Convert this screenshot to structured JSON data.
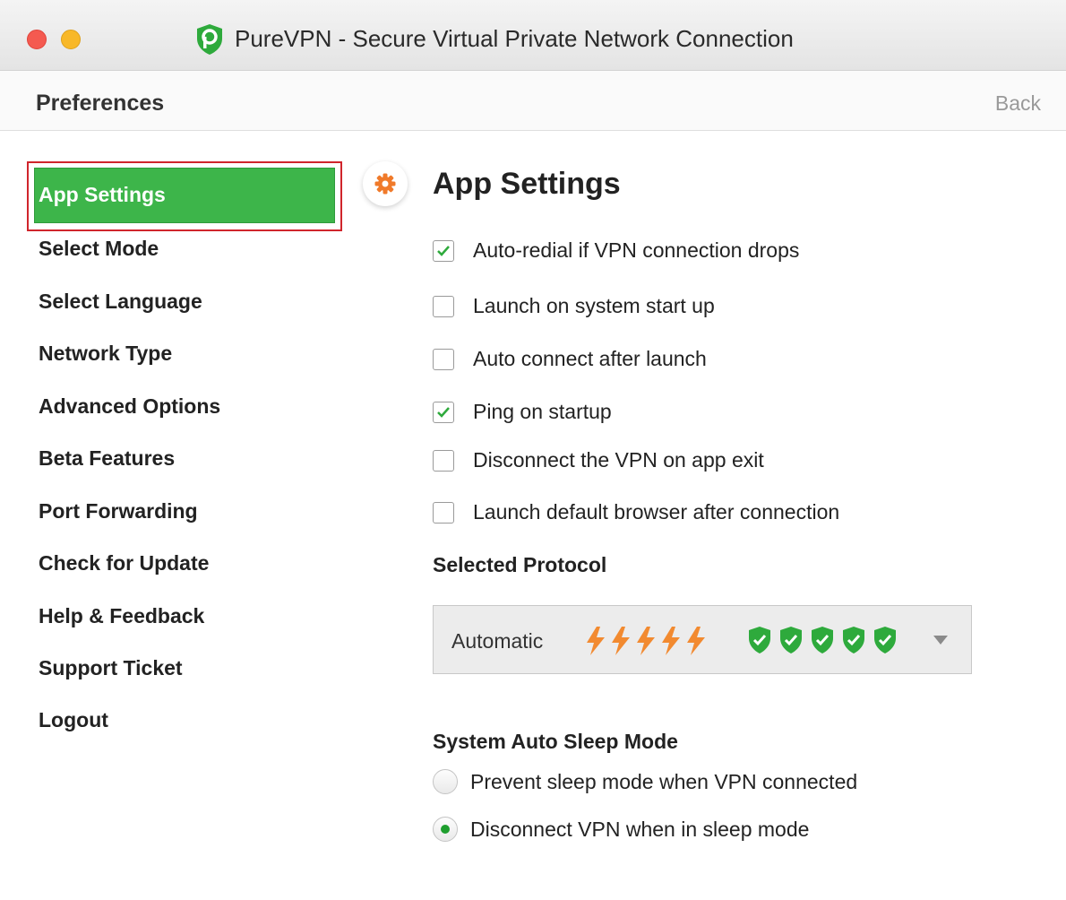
{
  "window": {
    "title": "PureVPN - Secure Virtual Private Network Connection",
    "icons": {
      "close": "close-dot-icon",
      "minimize": "minimize-dot-icon",
      "logo": "purevpn-shield-logo-icon"
    }
  },
  "header": {
    "title": "Preferences",
    "back_label": "Back"
  },
  "sidebar": {
    "active_label": "App Settings",
    "items": [
      "Select Mode",
      "Select Language",
      "Network Type",
      "Advanced Options",
      "Beta Features",
      "Port Forwarding",
      "Check for Update",
      "Help & Feedback",
      "Support Ticket",
      "Logout"
    ]
  },
  "main": {
    "section_icon": "gear-icon",
    "section_title": "App Settings",
    "options": [
      {
        "label": "Auto-redial if VPN connection drops",
        "checked": true
      },
      {
        "label": "Launch on system start up",
        "checked": false
      },
      {
        "label": "Auto connect after launch",
        "checked": false
      },
      {
        "label": "Ping on startup",
        "checked": true
      },
      {
        "label": "Disconnect the VPN on app exit",
        "checked": false
      },
      {
        "label": "Launch default browser after connection",
        "checked": false
      }
    ],
    "protocol": {
      "heading": "Selected Protocol",
      "value": "Automatic",
      "speed_rating": 5,
      "security_rating": 5,
      "icons": {
        "speed": "lightning-bolt-icon",
        "security": "shield-check-icon",
        "caret": "chevron-down-icon"
      }
    },
    "sleep": {
      "heading": "System Auto Sleep Mode",
      "options": [
        {
          "label": "Prevent sleep mode when VPN connected",
          "selected": false
        },
        {
          "label": "Disconnect VPN when in sleep mode",
          "selected": true
        }
      ]
    }
  },
  "colors": {
    "accent_green": "#3db54a",
    "highlight_red": "#d0252c",
    "bolt_orange": "#f28a30",
    "shield_green": "#2eaa3c"
  }
}
